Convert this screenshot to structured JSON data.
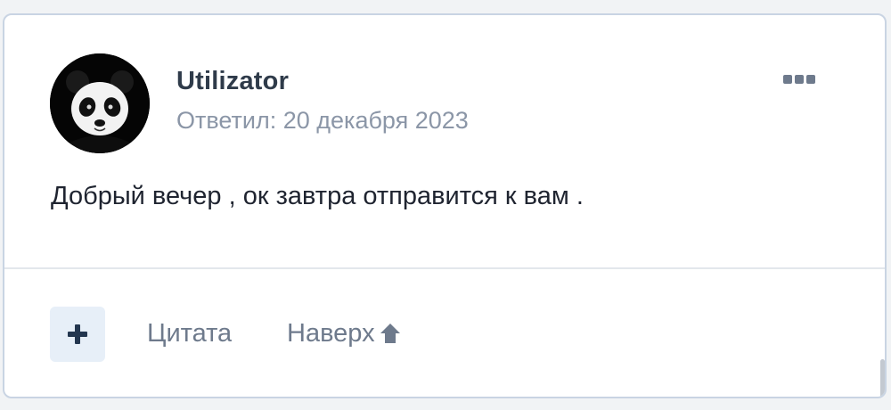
{
  "post": {
    "author": "Utilizator",
    "date": "Ответил: 20 декабря 2023",
    "text": "Добрый вечер , ок завтра отправится к вам .",
    "avatar_icon": "panda-avatar",
    "more_icon": "more-options-icon"
  },
  "actions": {
    "plus_icon": "plus-icon",
    "quote_label": "Цитата",
    "top_label": "Наверх",
    "top_icon": "arrow-up-icon"
  },
  "colors": {
    "accent": "#2f3b4a",
    "muted": "#8b96a7",
    "link": "#6e7a8c",
    "button_bg": "#e7eff8"
  }
}
